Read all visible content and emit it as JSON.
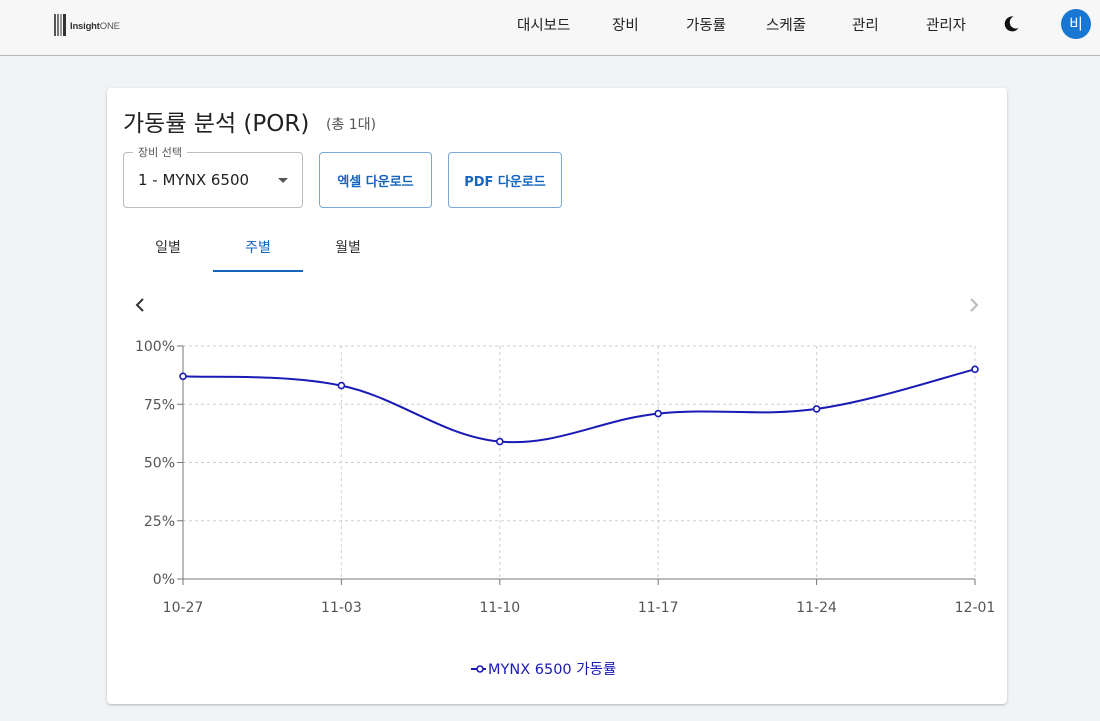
{
  "app": {
    "logo_text": "Insight",
    "logo_suffix": "ONE"
  },
  "nav": {
    "items": [
      "대시보드",
      "장비",
      "가동률",
      "스케줄",
      "관리",
      "관리자"
    ],
    "avatar": "비",
    "theme_icon": "moon-icon"
  },
  "page": {
    "title": "가동률 분석 (POR)",
    "count": "(총 1대)"
  },
  "equipment_select": {
    "label": "장비 선택",
    "value": "1 - MYNX 6500"
  },
  "buttons": {
    "excel": "엑셀 다운로드",
    "pdf": "PDF 다운로드"
  },
  "tabs": {
    "items": [
      "일별",
      "주별",
      "월별"
    ],
    "active": "주별"
  },
  "colors": {
    "accent": "#1565c0",
    "series": "#1a1ab4"
  },
  "chart_data": {
    "type": "line",
    "x": [
      "10-27",
      "11-03",
      "11-10",
      "11-17",
      "11-24",
      "12-01"
    ],
    "y_ticks": [
      "0%",
      "25%",
      "50%",
      "75%",
      "100%"
    ],
    "ylim": [
      0,
      100
    ],
    "grid": true,
    "legend_position": "bottom",
    "series": [
      {
        "name": "MYNX 6500 가동률",
        "values": [
          87,
          83,
          59,
          71,
          73,
          90
        ]
      }
    ]
  }
}
